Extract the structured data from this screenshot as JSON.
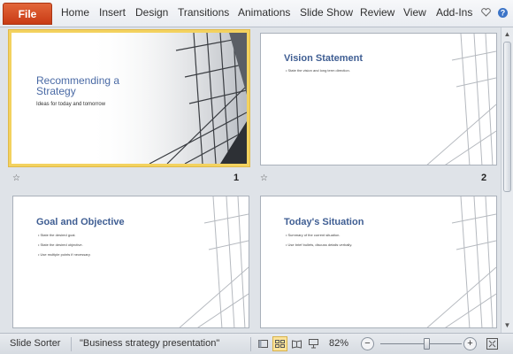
{
  "ribbon": {
    "file_label": "File",
    "tabs": [
      "Home",
      "Insert",
      "Design",
      "Transitions",
      "Animations",
      "Slide Show",
      "Review",
      "View",
      "Add-Ins"
    ],
    "icons": [
      "heart-icon",
      "help-icon"
    ]
  },
  "slides": [
    {
      "number": "1",
      "selected": true,
      "title": "Recommending a Strategy",
      "subtitle": "Ideas for today and tomorrow",
      "bullets": []
    },
    {
      "number": "2",
      "selected": false,
      "title": "Vision Statement",
      "subtitle": "",
      "bullets": [
        "State the vision and long term direction."
      ]
    },
    {
      "number": "",
      "selected": false,
      "title": "Goal and Objective",
      "subtitle": "",
      "bullets": [
        "State the desired goal.",
        "State the desired objective.",
        "Use multiple points if necessary."
      ]
    },
    {
      "number": "",
      "selected": false,
      "title": "Today's Situation",
      "subtitle": "",
      "bullets": [
        "Summary of the current situation.",
        "Use brief bullets, discuss details verbally."
      ]
    }
  ],
  "status": {
    "view_name": "Slide Sorter",
    "document_name": "\"Business strategy presentation\"",
    "zoom_label": "82%",
    "zoom_minus": "−",
    "zoom_plus": "+",
    "zoom_fraction": 0.56
  },
  "colors": {
    "file_tab": "#d24a20",
    "title_blue": "#3f5e93",
    "selection": "#f3d25f"
  }
}
